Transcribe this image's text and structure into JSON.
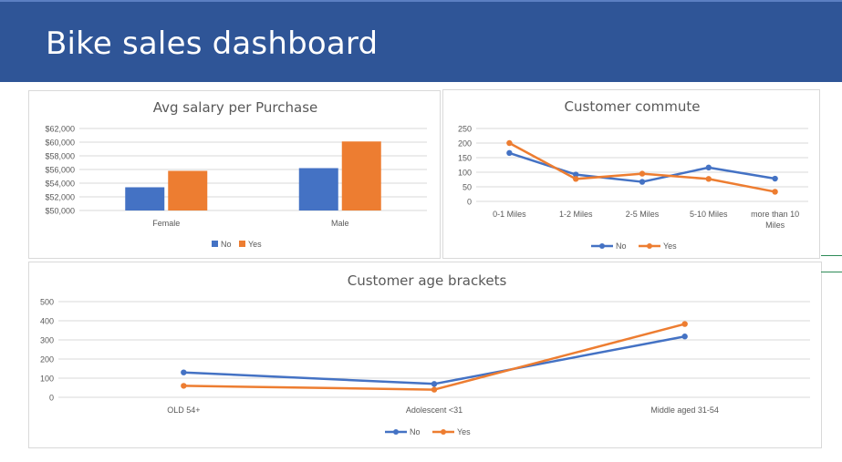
{
  "page": {
    "title": "Bike sales dashboard"
  },
  "colors": {
    "banner": "#2f5597",
    "no": "#4472c4",
    "yes": "#ed7d31",
    "grid": "#d9d9d9",
    "text": "#595959"
  },
  "chart_data": [
    {
      "type": "bar",
      "title": "Avg salary per Purchase",
      "categories": [
        "Female",
        "Male"
      ],
      "series": [
        {
          "name": "No",
          "values": [
            53400,
            56200
          ]
        },
        {
          "name": "Yes",
          "values": [
            55800,
            60100
          ]
        }
      ],
      "ylim": [
        50000,
        62000
      ],
      "yticks": [
        50000,
        52000,
        54000,
        56000,
        58000,
        60000,
        62000
      ],
      "ytick_labels": [
        "$50,000",
        "$52,000",
        "$54,000",
        "$56,000",
        "$58,000",
        "$60,000",
        "$62,000"
      ],
      "xlabel": "",
      "ylabel": "",
      "grid": true,
      "legend": "bottom"
    },
    {
      "type": "line",
      "title": "Customer commute",
      "categories": [
        "0-1 Miles",
        "1-2 Miles",
        "2-5 Miles",
        "5-10 Miles",
        "more than 10 Miles"
      ],
      "series": [
        {
          "name": "No",
          "values": [
            166,
            92,
            67,
            116,
            78
          ]
        },
        {
          "name": "Yes",
          "values": [
            200,
            77,
            95,
            77,
            33
          ]
        }
      ],
      "ylim": [
        0,
        250
      ],
      "yticks": [
        0,
        50,
        100,
        150,
        200,
        250
      ],
      "ytick_labels": [
        "0",
        "50",
        "100",
        "150",
        "200",
        "250"
      ],
      "xlabel": "",
      "ylabel": "",
      "grid": true,
      "legend": "bottom"
    },
    {
      "type": "line",
      "title": "Customer age brackets",
      "categories": [
        "OLD 54+",
        "Adolescent <31",
        "Middle aged 31-54"
      ],
      "series": [
        {
          "name": "No",
          "values": [
            130,
            70,
            318
          ]
        },
        {
          "name": "Yes",
          "values": [
            60,
            40,
            383
          ]
        }
      ],
      "ylim": [
        0,
        500
      ],
      "yticks": [
        0,
        100,
        200,
        300,
        400,
        500
      ],
      "ytick_labels": [
        "0",
        "100",
        "200",
        "300",
        "400",
        "500"
      ],
      "xlabel": "",
      "ylabel": "",
      "grid": true,
      "legend": "bottom"
    }
  ]
}
